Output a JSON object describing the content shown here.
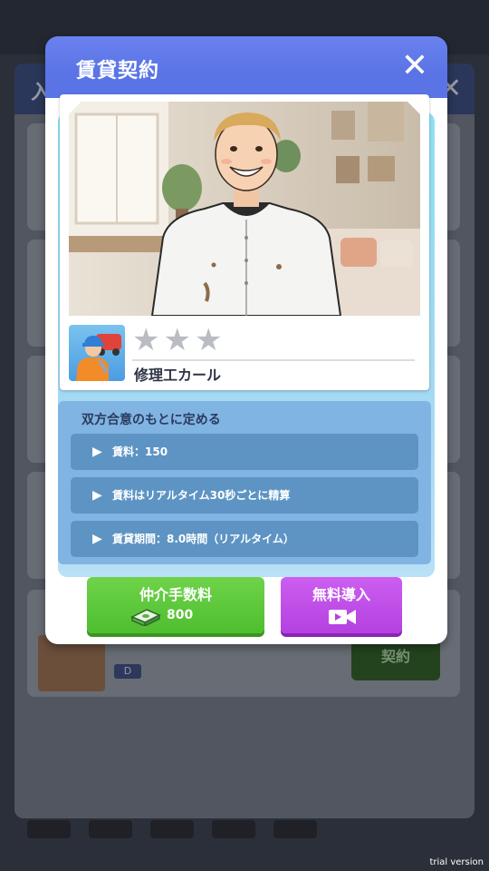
{
  "background": {
    "header_title": "入",
    "close_symbol": "✕",
    "contract_button": "契約",
    "rank_badge": "D"
  },
  "modal": {
    "title": "賃貸契約",
    "close_symbol": "✕"
  },
  "character": {
    "name": "修理工カール",
    "stars_total": 3,
    "stars_filled": 0,
    "star_glyph": "★"
  },
  "terms": {
    "heading": "双方合意のもとに定める",
    "arrow": "▶",
    "items": [
      "賃料：150",
      "賃料はリアルタイム30秒ごとに精算",
      "賃貸期間：8.0時間（リアルタイム）"
    ]
  },
  "buttons": {
    "broker_label": "仲介手数料",
    "broker_cost": "800",
    "free_label": "無料導入"
  },
  "watermark": "trial version",
  "colors": {
    "modal_header": "#5a74e6",
    "broker_button": "#58c436",
    "free_button": "#bd4ae4",
    "term_row": "#5d94c4",
    "terms_panel": "#80b4e2"
  }
}
